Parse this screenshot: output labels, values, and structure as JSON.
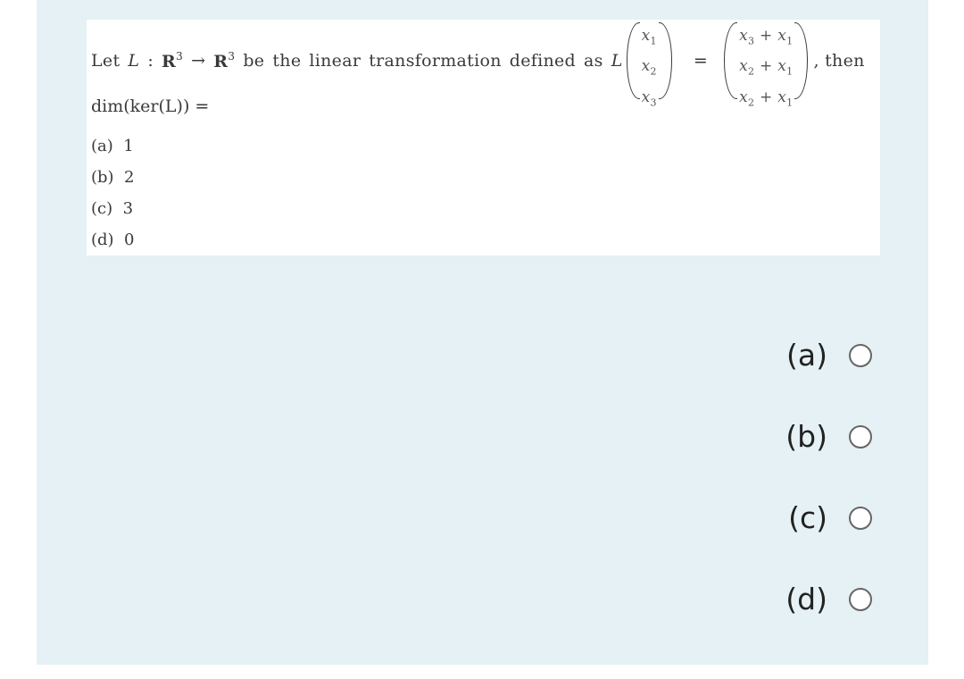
{
  "question": {
    "intro_words": [
      "Let",
      "L",
      ":",
      "R",
      "→",
      "R",
      "be",
      "the",
      "linear",
      "transformation",
      "defined",
      "as",
      "L"
    ],
    "domain_space": "R",
    "domain_exp": "3",
    "codomain_space": "R",
    "codomain_exp": "3",
    "input_vector": [
      "x1",
      "x2",
      "x3"
    ],
    "output_vector": [
      "x3 + x1",
      "x2 + x1",
      "x2 + x1"
    ],
    "equals": "=",
    "suffix": ", then",
    "query": "dim(ker(L)) =",
    "options": [
      {
        "label": "(a)",
        "value": "1"
      },
      {
        "label": "(b)",
        "value": "2"
      },
      {
        "label": "(c)",
        "value": "3"
      },
      {
        "label": "(d)",
        "value": "0"
      }
    ]
  },
  "answers": [
    {
      "label": "(a)",
      "selected": false
    },
    {
      "label": "(b)",
      "selected": false
    },
    {
      "label": "(c)",
      "selected": false
    },
    {
      "label": "(d)",
      "selected": false
    }
  ],
  "colors": {
    "card_background": "#e5f1f4",
    "question_background": "#ffffff",
    "text": "#3a3a3a"
  }
}
